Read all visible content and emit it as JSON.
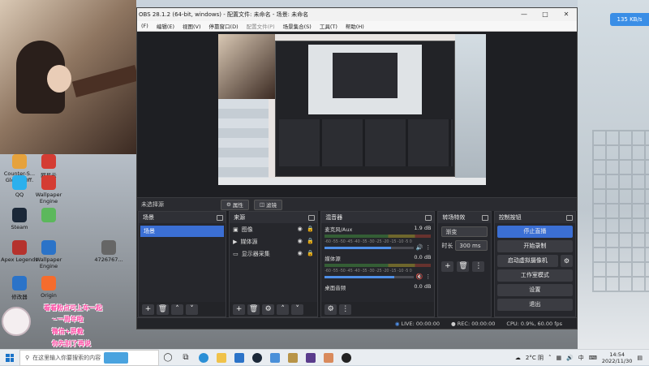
{
  "desktop": {
    "speed_chip": "135 KB/s",
    "icons": [
      {
        "label": "Counter-S... Global Off.",
        "color": "#e6a23c"
      },
      {
        "label": "网易云",
        "color": "#d43c33"
      },
      {
        "label": "QQ",
        "color": "#2bb0ed"
      },
      {
        "label": "Wallpaper Engine",
        "color": "#d43c33"
      },
      {
        "label": "Steam",
        "color": "#1b2838"
      },
      {
        "label": "",
        "color": "#5cb85c"
      },
      {
        "label": "Apex Legends",
        "color": "#b5322d"
      },
      {
        "label": "Wallpaper Engine",
        "color": "#2b73c8"
      },
      {
        "label": "4726767...",
        "color": "#666666"
      },
      {
        "label": "修改器",
        "color": "#2b73c8"
      },
      {
        "label": "Origin",
        "color": "#f56c2d"
      }
    ],
    "overlay": [
      "看看粉点可上车一起",
      "~一周年啦",
      "微信+屏截",
      "你先别了再说"
    ]
  },
  "obs": {
    "title": "OBS 28.1.2 (64-bit, windows) - 配置文件: 未命名 - 场景: 未命名",
    "menu": [
      "(F)",
      "编辑(E)",
      "视图(V)",
      "停靠窗口(D)",
      "配置文件(P)",
      "场景集合(S)",
      "工具(T)",
      "帮助(H)"
    ],
    "source_toolbar": {
      "no_source": "未选择源",
      "properties": "属性",
      "filters": "滤镜"
    },
    "scenes": {
      "title": "场景",
      "items": [
        "场景"
      ]
    },
    "sources": {
      "title": "来源",
      "items": [
        {
          "name": "图像",
          "icon": "image-icon"
        },
        {
          "name": "媒体源",
          "icon": "play-icon"
        },
        {
          "name": "显示器采集",
          "icon": "monitor-icon"
        }
      ]
    },
    "mixer": {
      "title": "混音器",
      "ticks": "-60 -55 -50 -45 -40 -35 -30 -25 -20 -15 -10 -5 0",
      "tracks": [
        {
          "name": "麦克风/Aux",
          "db": "1.9 dB",
          "level": 0.75,
          "muted": false
        },
        {
          "name": "媒体源",
          "db": "0.0 dB",
          "level": 0.78,
          "muted": true
        },
        {
          "name": "桌面音频",
          "db": "0.0 dB",
          "level": 0.78,
          "muted": false
        }
      ]
    },
    "transitions": {
      "title": "转场特效",
      "type": "渐变",
      "duration_label": "时长",
      "duration": "300 ms"
    },
    "controls": {
      "title": "控制按钮",
      "buttons": [
        "停止直播",
        "开始录制",
        "启动虚拟摄像机",
        "工作室模式",
        "设置",
        "退出"
      ]
    },
    "status": {
      "live": "LIVE: 00:00:00",
      "rec": "REC: 00:00:00",
      "cpu": "CPU: 0.9%, 60.00 fps"
    }
  },
  "taskbar": {
    "search_placeholder": "在这里输入你要搜索的内容",
    "weather": "2°C 阴",
    "ime": "中",
    "time": "14:54",
    "date": "2022/11/30"
  }
}
